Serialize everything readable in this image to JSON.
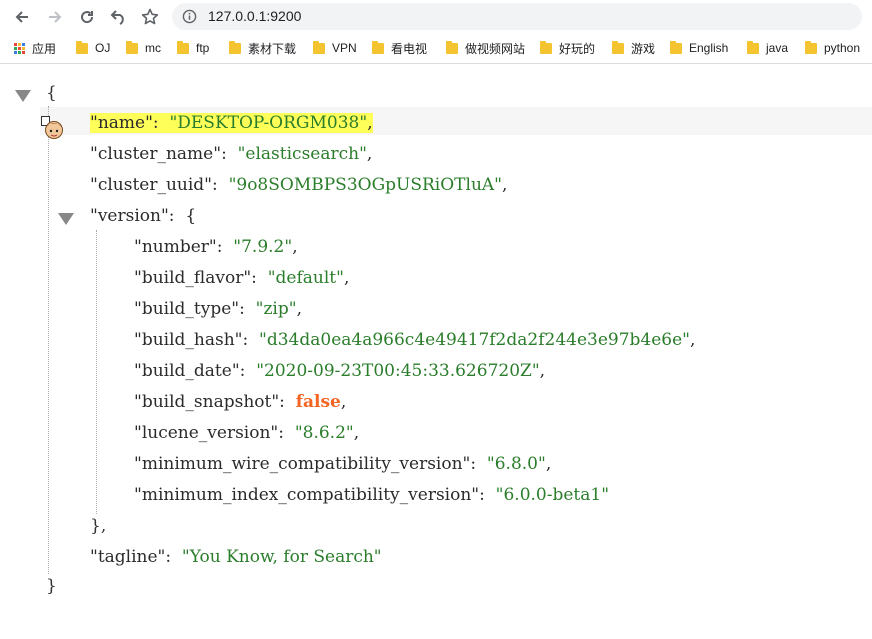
{
  "browser": {
    "url": "127.0.0.1:9200",
    "icons": [
      "back-icon",
      "forward-icon",
      "reload-icon",
      "undo-icon",
      "star-icon",
      "info-icon"
    ]
  },
  "bookmarks": [
    {
      "label": "应用",
      "icon": "apps-icon"
    },
    {
      "label": "OJ",
      "icon": "folder-icon"
    },
    {
      "label": "mc",
      "icon": "folder-icon"
    },
    {
      "label": "ftp",
      "icon": "folder-icon"
    },
    {
      "label": "素材下载",
      "icon": "folder-icon"
    },
    {
      "label": "VPN",
      "icon": "folder-icon"
    },
    {
      "label": "看电视",
      "icon": "folder-icon"
    },
    {
      "label": "做视频网站",
      "icon": "folder-icon"
    },
    {
      "label": "好玩的",
      "icon": "folder-icon"
    },
    {
      "label": "游戏",
      "icon": "folder-icon"
    },
    {
      "label": "English",
      "icon": "folder-icon"
    },
    {
      "label": "java",
      "icon": "folder-icon"
    },
    {
      "label": "python",
      "icon": "folder-icon"
    }
  ],
  "json": {
    "open_brace": "{",
    "close_brace": "}",
    "name_key": "\"name\"",
    "name_val": "\"DESKTOP-ORGM038\"",
    "cluster_name_key": "\"cluster_name\"",
    "cluster_name_val": "\"elasticsearch\"",
    "cluster_uuid_key": "\"cluster_uuid\"",
    "cluster_uuid_val": "\"9o8SOMBPS3OGpUSRiOTluA\"",
    "version_key": "\"version\"",
    "version_open": "{",
    "version_close": "},",
    "version": [
      {
        "key": "\"number\"",
        "val": "\"7.9.2\"",
        "comma": ","
      },
      {
        "key": "\"build_flavor\"",
        "val": "\"default\"",
        "comma": ","
      },
      {
        "key": "\"build_type\"",
        "val": "\"zip\"",
        "comma": ","
      },
      {
        "key": "\"build_hash\"",
        "val": "\"d34da0ea4a966c4e49417f2da2f244e3e97b4e6e\"",
        "comma": ","
      },
      {
        "key": "\"build_date\"",
        "val": "\"2020-09-23T00:45:33.626720Z\"",
        "comma": ","
      },
      {
        "key": "\"build_snapshot\"",
        "val": "false",
        "comma": ","
      },
      {
        "key": "\"lucene_version\"",
        "val": "\"8.6.2\"",
        "comma": ","
      },
      {
        "key": "\"minimum_wire_compatibility_version\"",
        "val": "\"6.8.0\"",
        "comma": ","
      },
      {
        "key": "\"minimum_index_compatibility_version\"",
        "val": "\"6.0.0-beta1\"",
        "comma": ""
      }
    ],
    "tagline_key": "\"tagline\"",
    "tagline_val": "\"You Know, for Search\"",
    "colon": ":",
    "comma": ","
  },
  "colors": {
    "string": "#2a7d2a",
    "boolean": "#f26522",
    "highlight": "#ffff5a"
  }
}
